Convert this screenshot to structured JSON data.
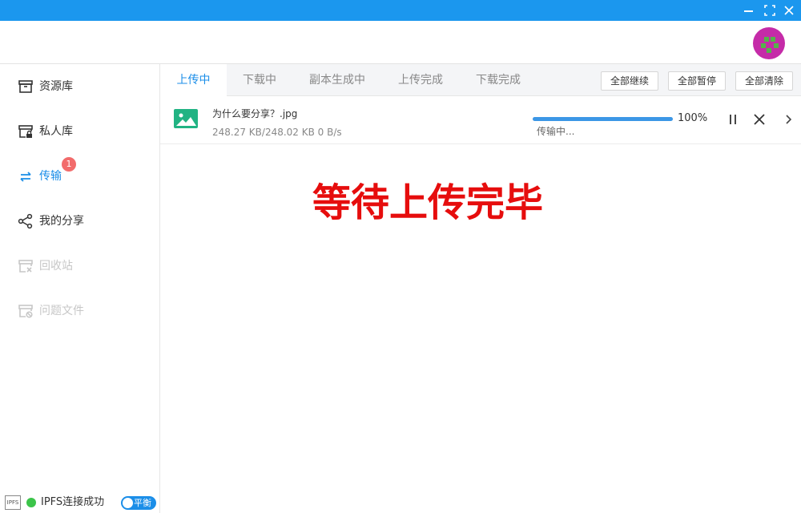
{
  "window": {
    "minimize": "minimize",
    "maximize": "maximize",
    "close": "close",
    "title_bar_color": "#1b97ee"
  },
  "sidebar": {
    "items": [
      {
        "label": "资源库",
        "icon": "archive-box-icon",
        "state": "normal"
      },
      {
        "label": "私人库",
        "icon": "locked-archive-icon",
        "state": "normal"
      },
      {
        "label": "传输",
        "icon": "transfer-arrows-icon",
        "state": "active",
        "badge": "1"
      },
      {
        "label": "我的分享",
        "icon": "share-icon",
        "state": "normal"
      },
      {
        "label": "回收站",
        "icon": "recycle-bin-icon",
        "state": "disabled"
      },
      {
        "label": "问题文件",
        "icon": "problem-file-icon",
        "state": "disabled"
      }
    ]
  },
  "status": {
    "ipfs_logo": "IPFS",
    "text": "IPFS连接成功",
    "toggle_label": "平衡"
  },
  "tabs": [
    {
      "label": "上传中",
      "active": true
    },
    {
      "label": "下载中",
      "active": false
    },
    {
      "label": "副本生成中",
      "active": false
    },
    {
      "label": "上传完成",
      "active": false
    },
    {
      "label": "下载完成",
      "active": false
    }
  ],
  "actions": {
    "resume_all": "全部继续",
    "pause_all": "全部暂停",
    "clear_all": "全部清除"
  },
  "tasks": [
    {
      "name": "为什么要分享？.jpg",
      "size": "248.27 KB/248.02 KB 0 B/s",
      "progress": 1.0,
      "progress_text": "100%",
      "status": "传输中..."
    }
  ],
  "overlay": {
    "text": "等待上传完毕"
  },
  "colors": {
    "accent": "#1b8ee8",
    "badge": "#f26b6b",
    "success": "#3cc44a",
    "file_icon": "#21b383",
    "overlay_text": "#e60d0d"
  }
}
